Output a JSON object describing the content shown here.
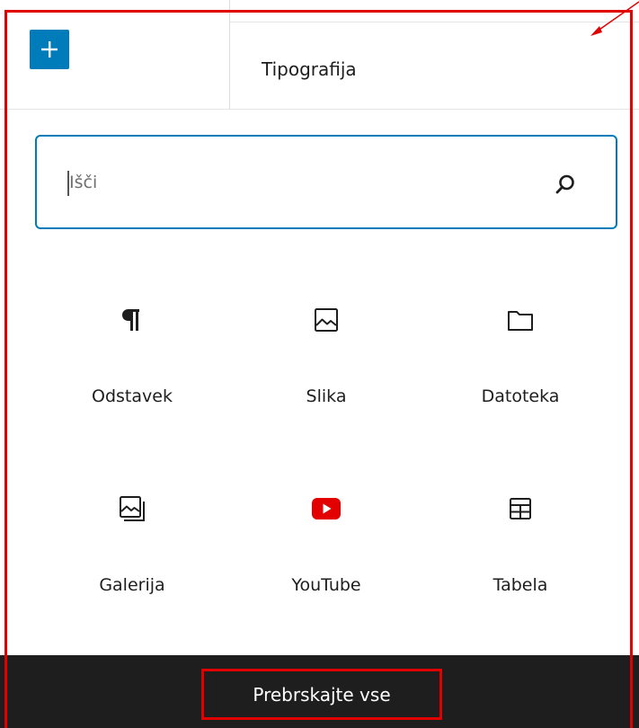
{
  "header": {
    "add_icon": "plus-icon",
    "tab_label": "Tipografija"
  },
  "search": {
    "placeholder": "Išči",
    "icon": "search-icon"
  },
  "blocks": [
    {
      "label": "Odstavek",
      "icon": "paragraph-icon"
    },
    {
      "label": "Slika",
      "icon": "image-icon"
    },
    {
      "label": "Datoteka",
      "icon": "folder-icon"
    },
    {
      "label": "Galerija",
      "icon": "gallery-icon"
    },
    {
      "label": "YouTube",
      "icon": "youtube-icon"
    },
    {
      "label": "Tabela",
      "icon": "table-icon"
    }
  ],
  "footer": {
    "browse_label": "Prebrskajte vse"
  },
  "colors": {
    "accent": "#007cba",
    "annotation": "#e10000",
    "youtube": "#e30000",
    "footer_bg": "#1e1e1e"
  }
}
